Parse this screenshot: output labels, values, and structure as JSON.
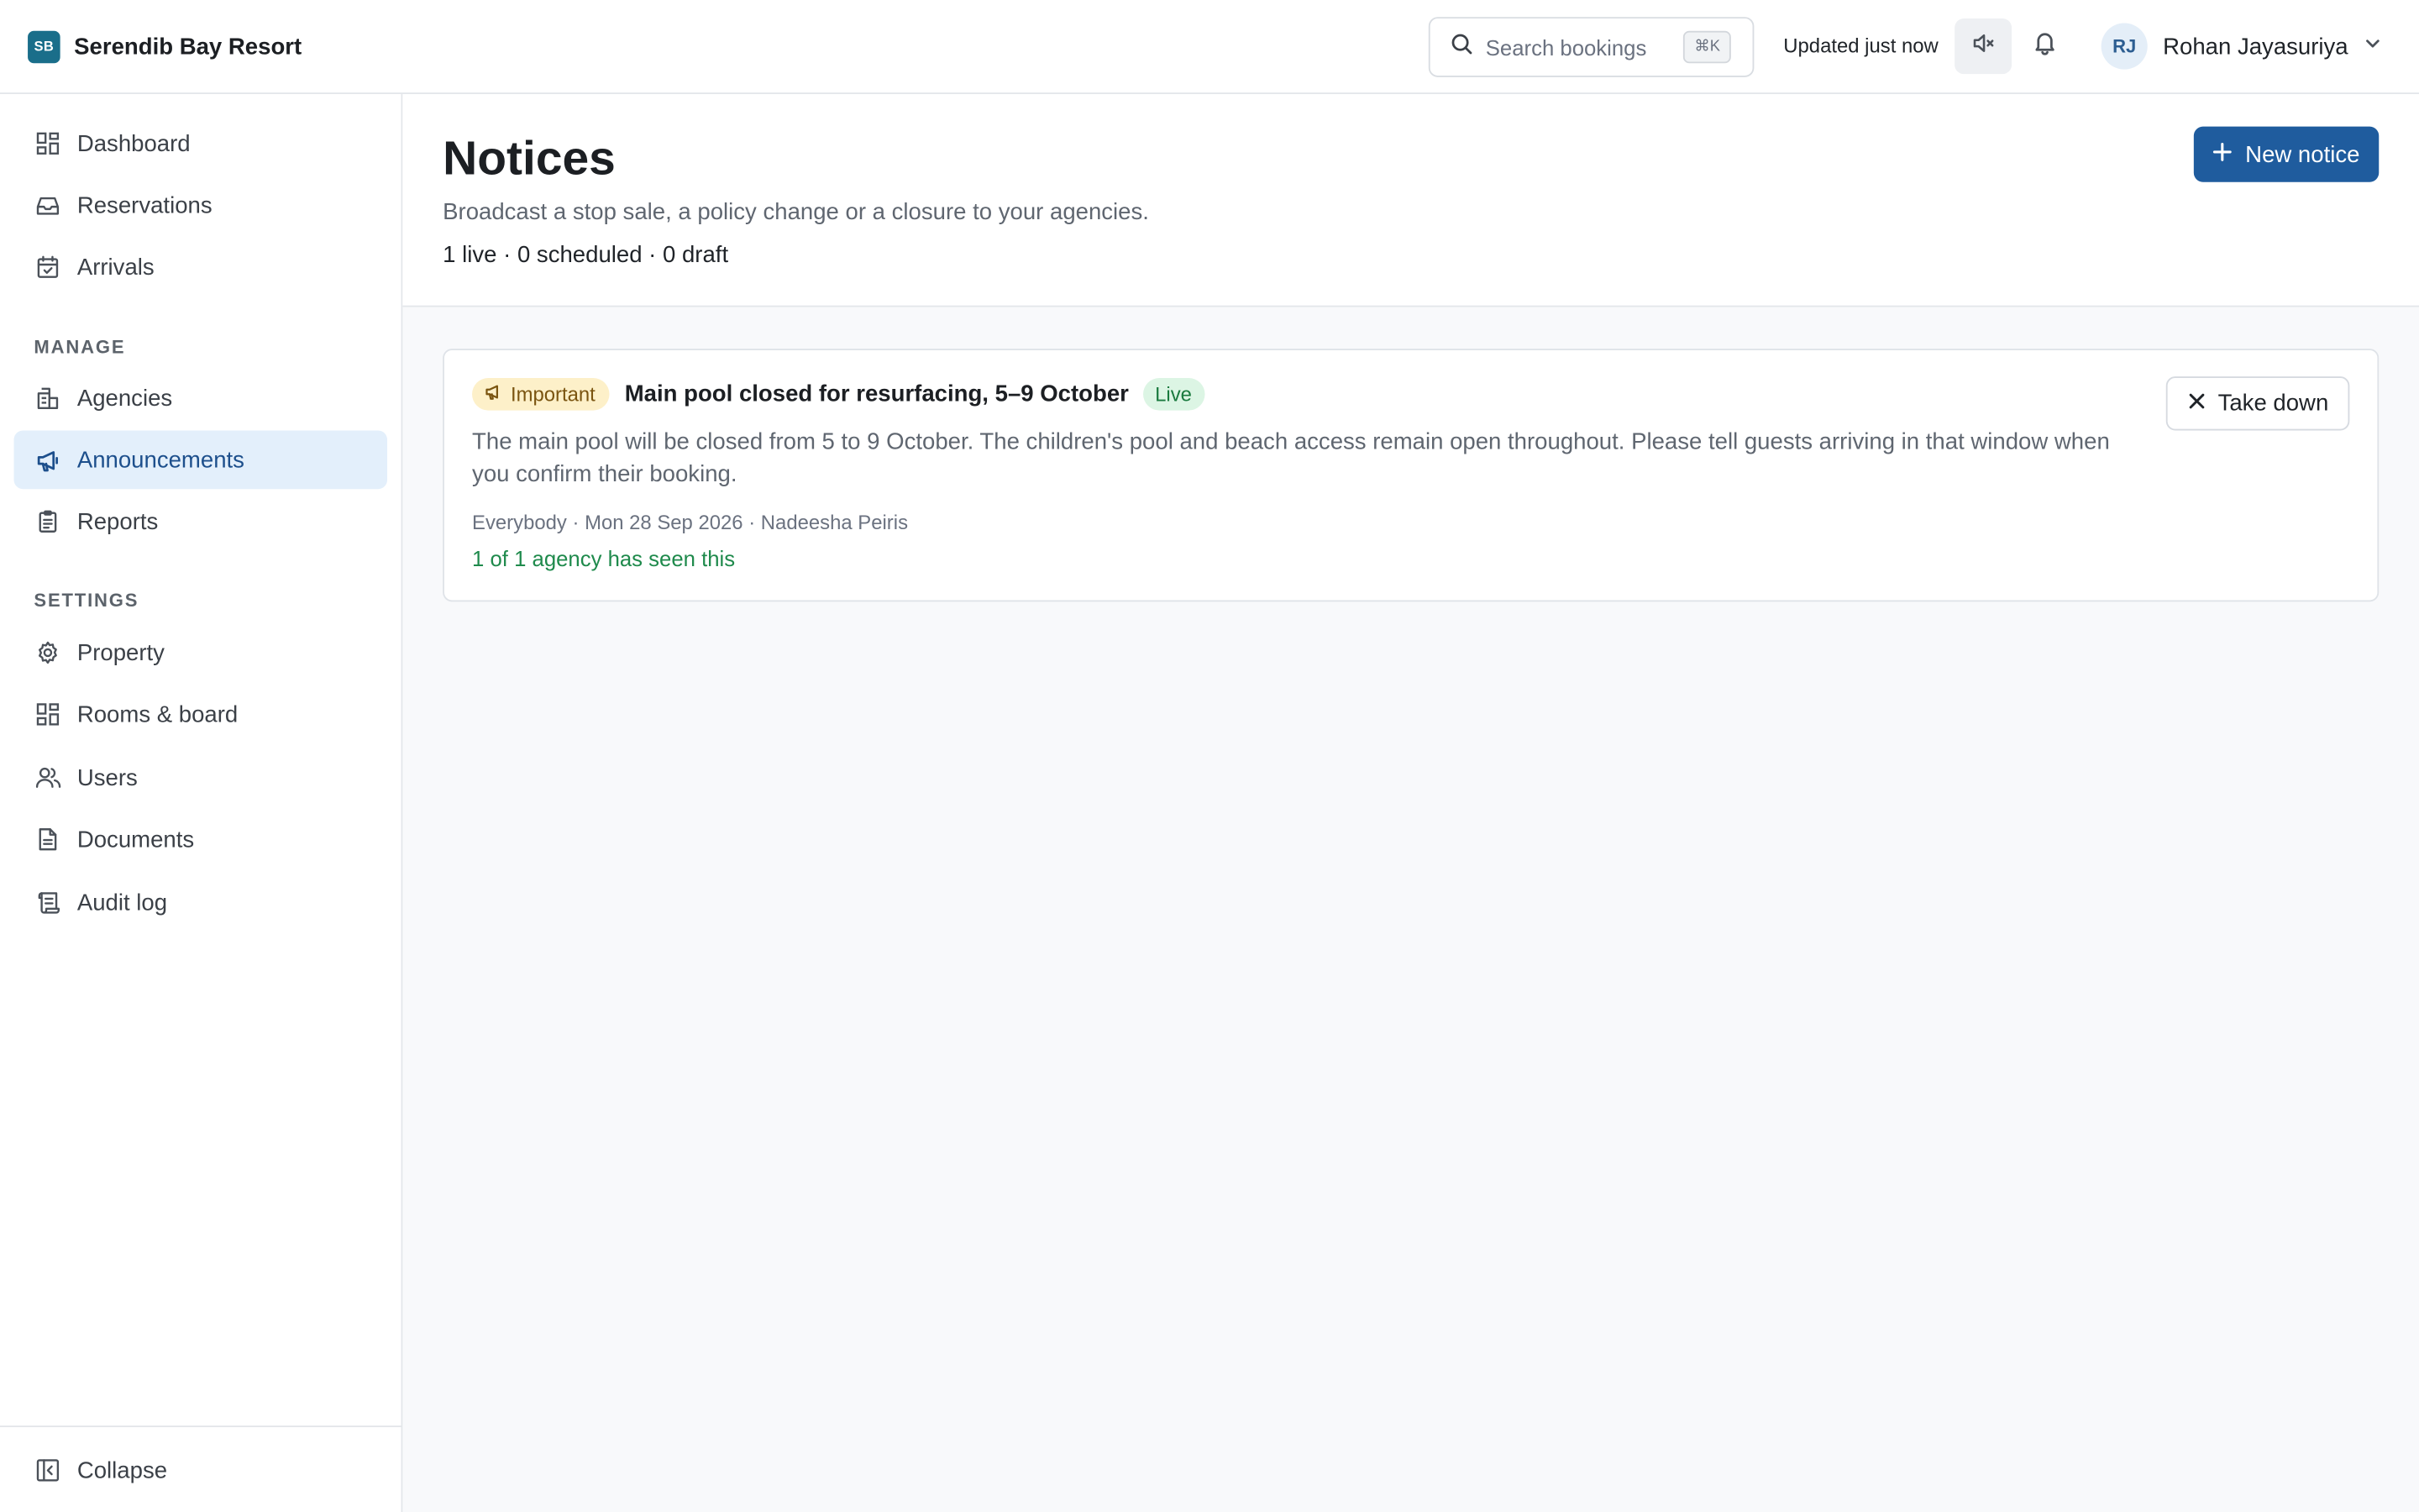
{
  "brand": {
    "logo_text": "SB",
    "name": "Serendib Bay Resort"
  },
  "topbar": {
    "search_placeholder": "Search bookings",
    "search_shortcut": "⌘K",
    "updated_text": "Updated just now",
    "user": {
      "initials": "RJ",
      "name": "Rohan Jayasuriya"
    }
  },
  "sidebar": {
    "primary": [
      {
        "label": "Dashboard",
        "icon": "dashboard-icon"
      },
      {
        "label": "Reservations",
        "icon": "inbox-icon"
      },
      {
        "label": "Arrivals",
        "icon": "calendar-check-icon"
      }
    ],
    "manage_title": "MANAGE",
    "manage": [
      {
        "label": "Agencies",
        "icon": "building-icon"
      },
      {
        "label": "Announcements",
        "icon": "megaphone-icon",
        "active": true
      },
      {
        "label": "Reports",
        "icon": "clipboard-icon"
      }
    ],
    "settings_title": "SETTINGS",
    "settings": [
      {
        "label": "Property",
        "icon": "gear-icon"
      },
      {
        "label": "Rooms & board",
        "icon": "grid-icon"
      },
      {
        "label": "Users",
        "icon": "users-icon"
      },
      {
        "label": "Documents",
        "icon": "document-icon"
      },
      {
        "label": "Audit log",
        "icon": "scroll-icon"
      }
    ],
    "collapse_label": "Collapse"
  },
  "page": {
    "title": "Notices",
    "subtitle": "Broadcast a stop sale, a policy change or a closure to your agencies.",
    "counts": "1 live · 0 scheduled · 0 draft",
    "new_button": "New notice"
  },
  "notices": [
    {
      "priority": "Important",
      "title": "Main pool closed for resurfacing, 5–9 October",
      "status": "Live",
      "body": "The main pool will be closed from 5 to 9 October. The children's pool and beach access remain open throughout. Please tell guests arriving in that window when you confirm their booking.",
      "meta": "Everybody · Mon 28 Sep 2026 · Nadeesha Peiris",
      "seen": "1 of 1 agency has seen this",
      "action": "Take down"
    }
  ],
  "colors": {
    "brand": "#1a6e8a",
    "primary_button": "#1f5c9e",
    "active_nav_bg": "#e3effb",
    "important_badge_bg": "#fdf0c9",
    "live_badge_bg": "#dcf5e4",
    "seen_text": "#1f8a4c"
  }
}
